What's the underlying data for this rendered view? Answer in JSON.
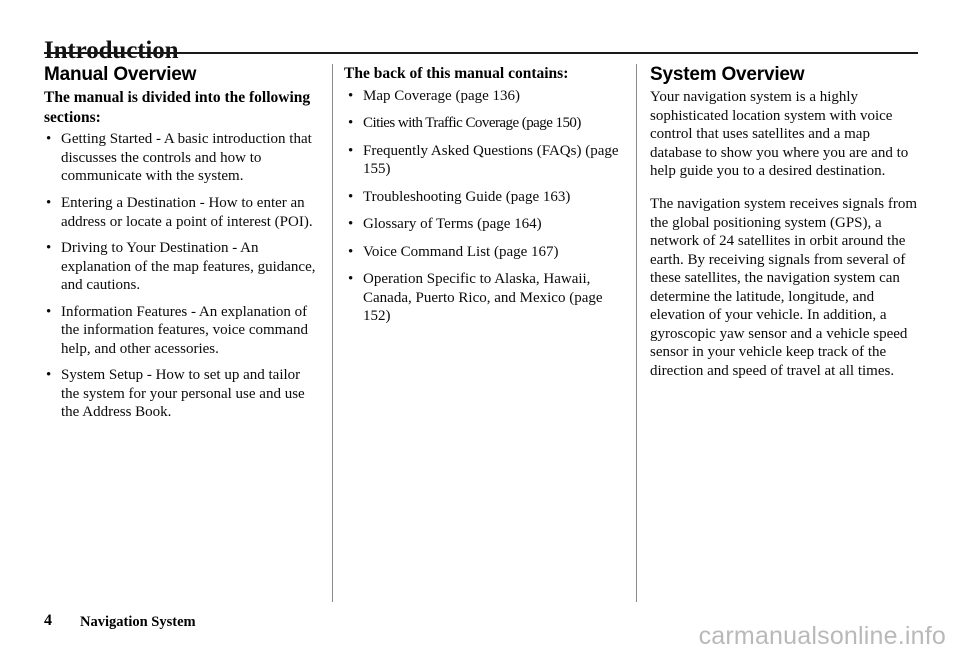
{
  "document": {
    "title": "Introduction",
    "footer": {
      "page_number": "4",
      "book_title": "Navigation System"
    },
    "watermark": "carmanualsonline.info"
  },
  "columns": {
    "left": {
      "heading": "Manual Overview",
      "lead": "The manual is divided into the following sections:",
      "bullet_glyph": "•",
      "bullets": [
        "Getting Started - A basic introduction that discusses the controls and how to communicate with the system.",
        "Entering a Destination - How to enter an address or locate a point of interest (POI).",
        "Driving to Your Destination - An explanation of the map features, guidance, and cautions.",
        "Information Features - An explanation of the information features, voice command help, and other acessories.",
        "System Setup - How to set up and tailor the system for your personal use and use the Address Book."
      ]
    },
    "middle": {
      "lead": "The back of this manual contains:",
      "bullet_glyph": "•",
      "bullets": [
        "Map Coverage (page 136)",
        "Cities with Traffic Coverage (page 150)",
        "Frequently Asked Questions (FAQs) (page 155)",
        "Troubleshooting Guide (page 163)",
        "Glossary of Terms (page 164)",
        "Voice Command List (page 167)",
        "Operation Specific to Alaska, Hawaii, Canada, Puerto Rico, and Mexico (page 152)"
      ]
    },
    "right": {
      "heading": "System Overview",
      "paragraphs": [
        "Your navigation system is a highly sophisticated location system with voice control that uses satellites and a map database to show you where you are and to help guide you to a desired destination.",
        "The navigation system receives signals from the global positioning system (GPS), a network of 24 satellites in orbit around the earth. By receiving signals from several of these satellites, the navigation system can determine the latitude, longitude, and elevation of your vehicle. In addition, a gyroscopic yaw sensor and a vehicle speed sensor in your vehicle keep track of the direction and speed of travel at all times."
      ]
    }
  }
}
